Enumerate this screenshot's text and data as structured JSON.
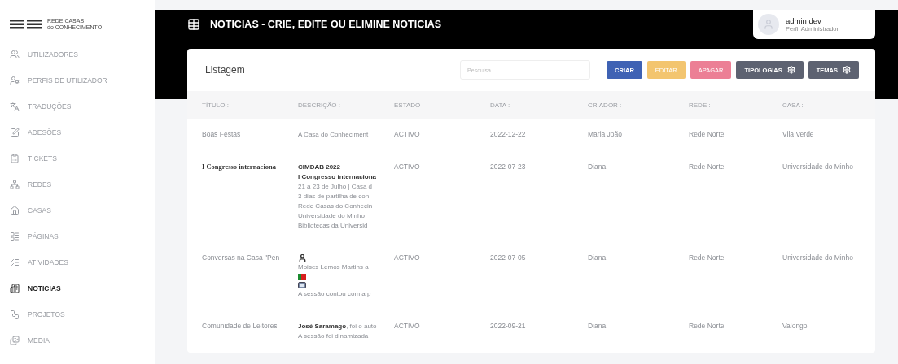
{
  "logo": {
    "line_1": "REDE CASAS",
    "line_2": "do CONHECIMENTO"
  },
  "sidebar": {
    "items": [
      {
        "label": "UTILIZADORES",
        "kind": "users",
        "selected": false
      },
      {
        "label": "PERFIS DE UTILIZADOR",
        "kind": "profiles",
        "selected": false
      },
      {
        "label": "TRADUÇÕES",
        "kind": "translate",
        "selected": false
      },
      {
        "label": "ADESÕES",
        "kind": "edit",
        "selected": false
      },
      {
        "label": "TICKETS",
        "kind": "ticket",
        "selected": false
      },
      {
        "label": "REDES",
        "kind": "network",
        "selected": false
      },
      {
        "label": "CASAS",
        "kind": "house",
        "selected": false
      },
      {
        "label": "PÁGINAS",
        "kind": "pages",
        "selected": false
      },
      {
        "label": "ATIVIDADES",
        "kind": "list",
        "selected": false
      },
      {
        "label": "NOTICIAS",
        "kind": "news",
        "selected": true
      },
      {
        "label": "PROJETOS",
        "kind": "project",
        "selected": false
      },
      {
        "label": "MEDIA",
        "kind": "media",
        "selected": false
      }
    ]
  },
  "header": {
    "title": "NOTICIAS - CRIE, EDITE OU ELIMINE NOTICIAS",
    "user": {
      "name": "admin dev",
      "role": "Perfil Administrador"
    }
  },
  "card": {
    "title": "Listagem",
    "search": {
      "placeholder": "Pesquisa"
    },
    "buttons": [
      {
        "label": "CRIAR",
        "color": "#3f62b4",
        "disabled": false,
        "gear": false
      },
      {
        "label": "EDITAR",
        "color": "#f3c56f",
        "disabled": true,
        "gear": false
      },
      {
        "label": "APAGAR",
        "color": "#ec7f95",
        "disabled": true,
        "gear": false
      },
      {
        "label": "TIPOLOGIAS",
        "color": "#5d6271",
        "disabled": false,
        "gear": true
      },
      {
        "label": "TEMAS",
        "color": "#5d6271",
        "disabled": false,
        "gear": true
      }
    ]
  },
  "table": {
    "columns": [
      "TÍTULO :",
      "DESCRIÇÃO :",
      "ESTADO :",
      "DATA :",
      "CRIADOR :",
      "REDE :",
      "CASA :"
    ],
    "rows": [
      {
        "title": "Boas Festas",
        "title_bold": false,
        "description": [
          {
            "kind": "text",
            "text": "A Casa do Conheciment"
          }
        ],
        "status": "ACTIVO",
        "date": "2022-12-22",
        "creator": "Maria João",
        "network": "Rede Norte",
        "house": "Vila Verde"
      },
      {
        "title": "I Congresso internaciona",
        "title_bold": true,
        "description": [
          {
            "kind": "text",
            "text": "**CIMDAB 2022**"
          },
          {
            "kind": "text",
            "text": "**I Congresso internaciona**"
          },
          {
            "kind": "text",
            "text": "21 a 23 de Julho | Casa d"
          },
          {
            "kind": "text",
            "text": "3 dias de partilha de con"
          },
          {
            "kind": "text",
            "text": "Rede Casas do Conhecin"
          },
          {
            "kind": "text",
            "text": "Universidade do Minho"
          },
          {
            "kind": "text",
            "text": "Bibliotecas da Universid"
          }
        ],
        "status": "ACTIVO",
        "date": "2022-07-23",
        "creator": "Diana",
        "network": "Rede Norte",
        "house": "Universidade do Minho"
      },
      {
        "title": "Conversas na Casa \"Pen",
        "title_bold": false,
        "description": [
          {
            "kind": "person"
          },
          {
            "kind": "text",
            "text": "Moises Lemos Martins a"
          },
          {
            "kind": "flag"
          },
          {
            "kind": "screen"
          },
          {
            "kind": "text",
            "text": "A sessão contou com a p"
          }
        ],
        "status": "ACTIVO",
        "date": "2022-07-05",
        "creator": "Diana",
        "network": "Rede Norte",
        "house": "Universidade do Minho"
      },
      {
        "title": "Comunidade de Leitores",
        "title_bold": false,
        "description": [
          {
            "kind": "text",
            "text": "**José Saramago**, foi o auto"
          },
          {
            "kind": "text",
            "text": "A sessão foi dinamizada"
          }
        ],
        "status": "ACTIVO",
        "date": "2022-09-21",
        "creator": "Diana",
        "network": "Rede Norte",
        "house": "Valongo"
      }
    ]
  }
}
